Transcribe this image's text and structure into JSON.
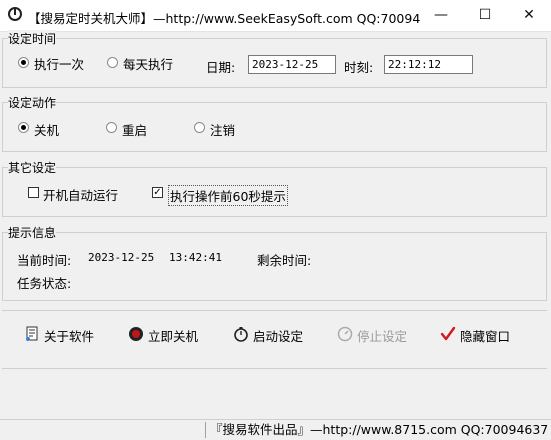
{
  "window": {
    "title": "【搜易定时关机大师】—http://www.SeekEasySoft.com QQ:70094...",
    "minimize": "—",
    "maximize": "☐",
    "close": "✕"
  },
  "set_time": {
    "title": "设定时间",
    "once_label": "执行一次",
    "daily_label": "每天执行",
    "date_label": "日期:",
    "date_value": "2023-12-25",
    "time_label": "时刻:",
    "time_value": "22:12:12",
    "selected": "once"
  },
  "set_action": {
    "title": "设定动作",
    "options": [
      "关机",
      "重启",
      "注销"
    ],
    "selected": "关机"
  },
  "other": {
    "title": "其它设定",
    "autostart_label": "开机自动运行",
    "autostart_checked": false,
    "prompt_label": "执行操作前60秒提示",
    "prompt_checked": true
  },
  "info": {
    "title": "提示信息",
    "current_label": "当前时间:",
    "current_date": "2023-12-25",
    "current_time": "13:42:41",
    "remain_label": "剩余时间:",
    "task_label": "任务状态:"
  },
  "toolbar": {
    "about": "关于软件",
    "shutdown_now": "立即关机",
    "start": "启动设定",
    "stop": "停止设定",
    "hide": "隐藏窗口"
  },
  "status": {
    "text": "『搜易软件出品』—http://www.8715.com QQ:70094637"
  },
  "colors": {
    "window_bg": "#f0f0f0",
    "disabled_text": "#9a9a9a",
    "hide_check": "#d0191b"
  }
}
